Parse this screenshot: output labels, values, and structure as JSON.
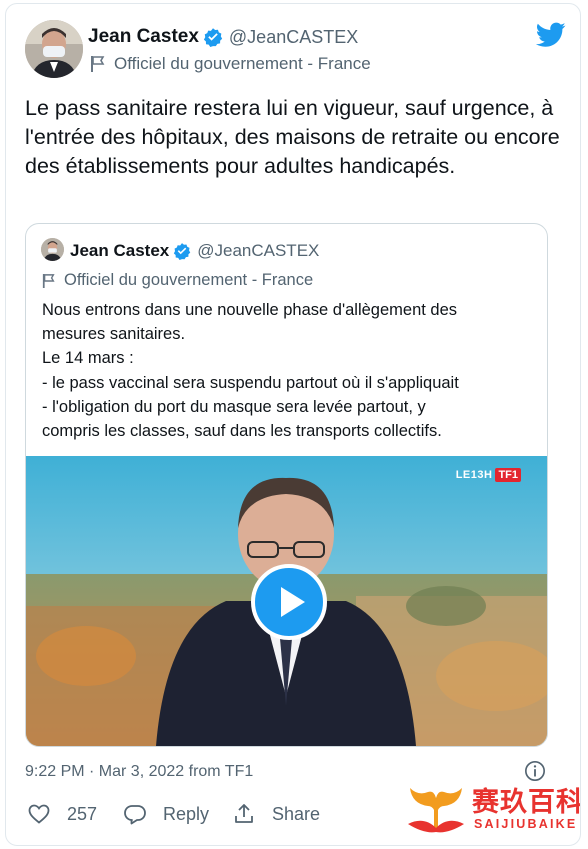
{
  "tweet": {
    "author_name": "Jean Castex",
    "author_handle": "@JeanCASTEX",
    "account_label": "Officiel du gouvernement - France",
    "text": "Le pass sanitaire restera lui en vigueur, sauf urgence, à l'entrée des hôpitaux, des maisons de retraite ou encore des établissements pour adultes handicapés.",
    "timestamp": "9:22 PM · Mar 3, 2022 from TF1",
    "brand_color": "#1d9bf0"
  },
  "quoted_tweet": {
    "author_name": "Jean Castex",
    "author_handle": "@JeanCASTEX",
    "account_label": "Officiel du gouvernement - France",
    "lines": [
      "Nous entrons dans une nouvelle phase d'allègement des",
      "mesures sanitaires.",
      "Le 14 mars :",
      "- le pass vaccinal sera suspendu partout où il s'appliquait",
      "- l'obligation du port du masque sera levée partout, y",
      "compris les classes, sauf dans les transports collectifs."
    ],
    "video": {
      "show_label": "LE13H",
      "channel_label": "TF1",
      "play_icon": "play-icon"
    }
  },
  "actions": {
    "like_count": "257",
    "reply_label": "Reply",
    "share_label": "Share"
  },
  "watermark": {
    "chinese_text": "赛玖百科",
    "latin_text": "SAIJIUBAIKE"
  }
}
